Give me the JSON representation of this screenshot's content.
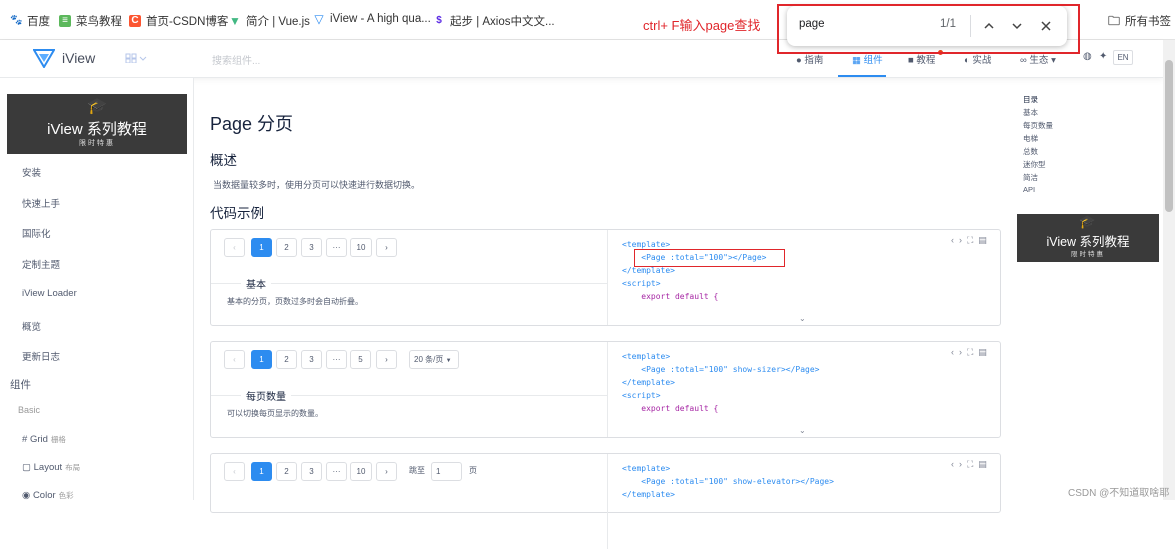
{
  "bookmarks": [
    {
      "label": "百度",
      "icon": "baidu-icon",
      "color": "#2932e1"
    },
    {
      "label": "菜鸟教程",
      "icon": "runoob-icon",
      "color": "#5cb85c"
    },
    {
      "label": "首页-CSDN博客",
      "icon": "csdn-icon",
      "color": "#fc5531"
    },
    {
      "label": "简介 | Vue.js",
      "icon": "vue-icon",
      "color": "#42b883"
    },
    {
      "label": "iView - A high qua...",
      "icon": "iview-icon",
      "color": "#2d8cf0"
    },
    {
      "label": "起步 | Axios中文文...",
      "icon": "axios-icon",
      "color": "#5a29e4"
    }
  ],
  "all_bookmarks": "所有书签",
  "annotation_text": "ctrl+ F输入page查找",
  "find_bar": {
    "query": "page",
    "count": "1/1"
  },
  "header": {
    "logo": "iView",
    "search_placeholder": "搜索组件...",
    "nav": [
      "指南",
      "组件",
      "教程",
      "实战",
      "生态"
    ],
    "active_nav": "组件",
    "lang": "EN"
  },
  "banner": {
    "title": "iView 系列教程",
    "subtitle": "限时特惠"
  },
  "sidebar": {
    "items": [
      "安装",
      "快速上手",
      "国际化",
      "定制主题",
      "iView Loader",
      "概览",
      "更新日志"
    ],
    "group": "组件",
    "subgroup": "Basic",
    "components": [
      {
        "label": "Grid",
        "sub": "栅格",
        "icon": "grid-icon"
      },
      {
        "label": "Layout",
        "sub": "布局",
        "icon": "layout-icon"
      },
      {
        "label": "Color",
        "sub": "色彩",
        "icon": "color-icon"
      }
    ]
  },
  "main": {
    "title": "Page 分页",
    "overview_heading": "概述",
    "overview_text": "当数据量较多时，使用分页可以快速进行数据切换。",
    "examples_heading": "代码示例",
    "demos": [
      {
        "pages": [
          "1",
          "2",
          "3",
          "···",
          "10"
        ],
        "title": "基本",
        "desc": "基本的分页，页数过多时会自动折叠。",
        "code": [
          "<template>",
          "    <Page :total=\"100\"></Page>",
          "</template>",
          "<script>",
          "    export default {",
          "        "
        ]
      },
      {
        "pages": [
          "1",
          "2",
          "3",
          "···",
          "5"
        ],
        "sizer": "20 条/页",
        "title": "每页数量",
        "desc": "可以切换每页显示的数量。",
        "code": [
          "<template>",
          "    <Page :total=\"100\" show-sizer></Page>",
          "</template>",
          "<script>",
          "    export default {",
          "        "
        ]
      },
      {
        "pages": [
          "1",
          "2",
          "3",
          "···",
          "10"
        ],
        "jump_label": "跳至",
        "jump_value": "1",
        "jump_unit": "页",
        "code": [
          "<template>",
          "    <Page :total=\"100\" show-elevator></Page>",
          "</template>"
        ]
      }
    ]
  },
  "anchor": {
    "title": "目录",
    "items": [
      "基本",
      "每页数量",
      "电梯",
      "总数",
      "迷你型",
      "简洁",
      "API"
    ]
  },
  "watermark": "CSDN @不知道取啥耶"
}
